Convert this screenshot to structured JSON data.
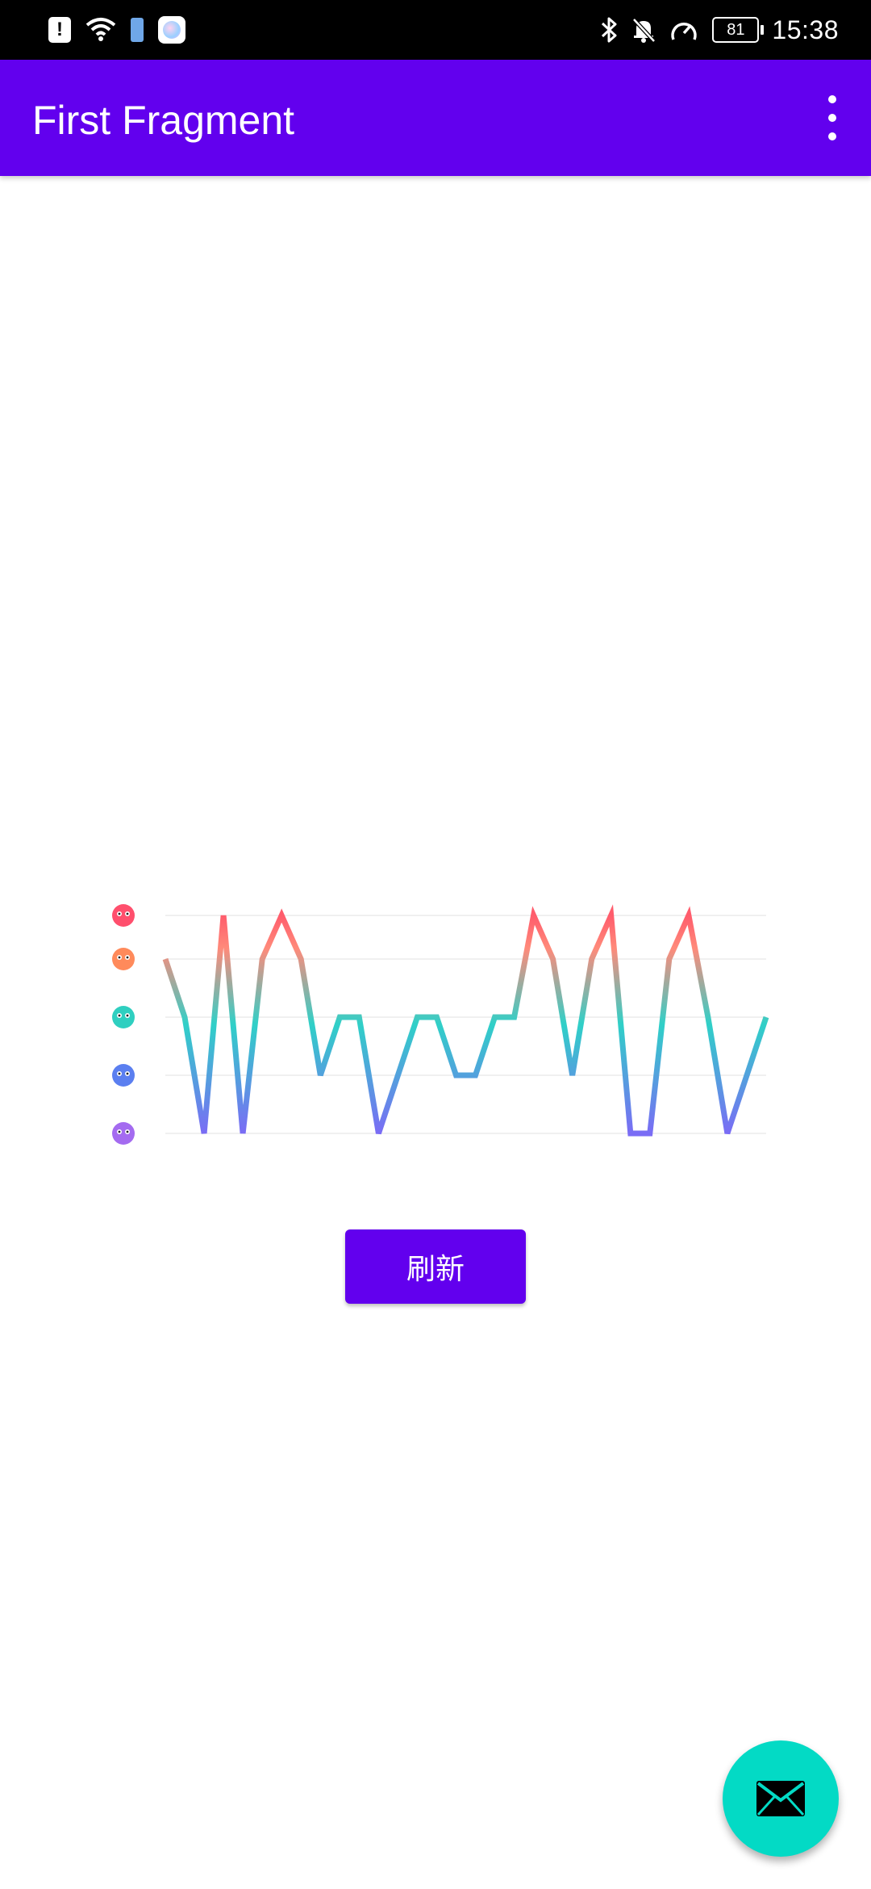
{
  "status_bar": {
    "time": "15:38",
    "battery_level": "81",
    "left_icons": [
      "alert-icon",
      "wifi-icon",
      "battery-saver-icon",
      "app-notification-icon"
    ],
    "right_icons": [
      "bluetooth-icon",
      "notifications-off-icon",
      "speedometer-icon",
      "battery-icon"
    ]
  },
  "app_bar": {
    "title": "First Fragment",
    "overflow_icon": "more-vert-icon",
    "background": "#6200EE"
  },
  "chart_data": {
    "type": "line",
    "title": "",
    "xlabel": "",
    "ylabel": "",
    "y_levels": [
      {
        "value": 1,
        "icon": "purple-face-icon",
        "color": "#a46bf0"
      },
      {
        "value": 2,
        "icon": "blue-face-icon",
        "color": "#5b7ff0"
      },
      {
        "value": 3,
        "icon": "teal-face-icon",
        "color": "#2fcfc0"
      },
      {
        "value": 4,
        "icon": "orange-face-icon",
        "color": "#ff8a5b"
      },
      {
        "value": 5,
        "icon": "red-face-icon",
        "color": "#ff4f6d"
      }
    ],
    "ylim": [
      1,
      5
    ],
    "x": [
      0,
      1,
      2,
      3,
      4,
      5,
      6,
      7,
      8,
      9,
      10,
      11,
      12,
      13,
      14,
      15,
      16,
      17,
      18,
      19,
      20,
      21,
      22,
      23,
      24,
      25,
      26,
      27,
      28,
      29,
      30,
      31
    ],
    "values": [
      4,
      3,
      1,
      5,
      1,
      4,
      5,
      4,
      2,
      3,
      3,
      1,
      2,
      3,
      3,
      2,
      2,
      3,
      3,
      5,
      4,
      2,
      4,
      5,
      1,
      1,
      4,
      5,
      3,
      1,
      2,
      3
    ],
    "gradient_colors": [
      "#ff5c6c",
      "#2fd0c8",
      "#7a6cf5"
    ],
    "grid": true,
    "legend": "none"
  },
  "refresh_button": {
    "label": "刷新"
  },
  "fab": {
    "icon": "email-icon",
    "color": "#03DAC5"
  }
}
